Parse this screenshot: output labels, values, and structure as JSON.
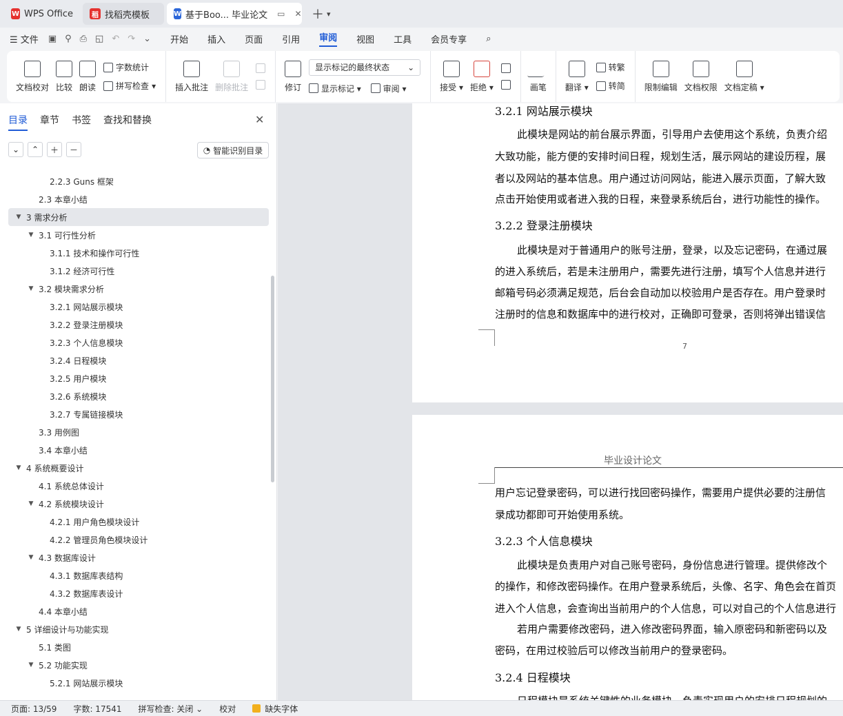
{
  "tabs": [
    {
      "label": "WPS Office"
    },
    {
      "label": "找稻壳模板"
    },
    {
      "label": "基于Boo... 毕业论文"
    }
  ],
  "menubar": {
    "file": "文件",
    "tabs": [
      "开始",
      "插入",
      "页面",
      "引用",
      "审阅",
      "视图",
      "工具",
      "会员专享"
    ],
    "selected_tab": "审阅"
  },
  "ribbon": {
    "doc_check": "文档校对",
    "compare": "比较",
    "read": "朗读",
    "word_count": "字数统计",
    "spell_check": "拼写检查",
    "insert_comment": "插入批注",
    "delete_comment": "删除批注",
    "track_changes": "修订",
    "show_markup_state": "显示标记的最终状态",
    "show_markup": "显示标记",
    "review": "审阅",
    "accept": "接受",
    "reject": "拒绝",
    "pen": "画笔",
    "translate": "翻译",
    "to_traditional": "转繁",
    "to_simplified": "转简",
    "restrict_edit": "限制编辑",
    "doc_permission": "文档权限",
    "doc_finalize": "文档定稿"
  },
  "nav": {
    "tabs": [
      "目录",
      "章节",
      "书签",
      "查找和替换"
    ],
    "smart_toc": "智能识别目录",
    "items": [
      {
        "text": "2.2.3 Guns 框架",
        "level": 3,
        "arrow": ""
      },
      {
        "text": "2.3  本章小结",
        "level": 2,
        "arrow": ""
      },
      {
        "text": "3  需求分析",
        "level": 1,
        "arrow": "▼",
        "selected": true
      },
      {
        "text": "3.1  可行性分析",
        "level": 2,
        "arrow": "▼"
      },
      {
        "text": "3.1.1 技术和操作可行性",
        "level": 3,
        "arrow": ""
      },
      {
        "text": "3.1.2 经济可行性",
        "level": 3,
        "arrow": ""
      },
      {
        "text": "3.2  模块需求分析",
        "level": 2,
        "arrow": "▼"
      },
      {
        "text": "3.2.1  网站展示模块",
        "level": 3,
        "arrow": ""
      },
      {
        "text": "3.2.2  登录注册模块",
        "level": 3,
        "arrow": ""
      },
      {
        "text": "3.2.3  个人信息模块",
        "level": 3,
        "arrow": ""
      },
      {
        "text": "3.2.4  日程模块",
        "level": 3,
        "arrow": ""
      },
      {
        "text": "3.2.5  用户模块",
        "level": 3,
        "arrow": ""
      },
      {
        "text": "3.2.6  系统模块",
        "level": 3,
        "arrow": ""
      },
      {
        "text": "3.2.7  专属链接模块",
        "level": 3,
        "arrow": ""
      },
      {
        "text": "3.3  用例图",
        "level": 2,
        "arrow": ""
      },
      {
        "text": "3.4  本章小结",
        "level": 2,
        "arrow": ""
      },
      {
        "text": "4  系统概要设计",
        "level": 1,
        "arrow": "▼"
      },
      {
        "text": "4.1  系统总体设计",
        "level": 2,
        "arrow": ""
      },
      {
        "text": "4.2  系统模块设计",
        "level": 2,
        "arrow": "▼"
      },
      {
        "text": "4.2.1  用户角色模块设计",
        "level": 3,
        "arrow": ""
      },
      {
        "text": "4.2.2  管理员角色模块设计",
        "level": 3,
        "arrow": ""
      },
      {
        "text": "4.3  数据库设计",
        "level": 2,
        "arrow": "▼"
      },
      {
        "text": "4.3.1  数据库表结构",
        "level": 3,
        "arrow": ""
      },
      {
        "text": "4.3.2  数据库表设计",
        "level": 3,
        "arrow": ""
      },
      {
        "text": "4.4  本章小结",
        "level": 2,
        "arrow": ""
      },
      {
        "text": "5  详细设计与功能实现",
        "level": 1,
        "arrow": "▼"
      },
      {
        "text": "5.1  类图",
        "level": 2,
        "arrow": ""
      },
      {
        "text": "5.2  功能实现",
        "level": 2,
        "arrow": "▼"
      },
      {
        "text": "5.2.1  网站展示模块",
        "level": 3,
        "arrow": ""
      }
    ]
  },
  "page1": {
    "h1": "3.2.1  网站展示模块",
    "p1": [
      "此模块是网站的前台展示界面，引导用户去使用这个系统，负责介绍",
      "大致功能，能方便的安排时间日程，规划生活，展示网站的建设历程，展",
      "者以及网站的基本信息。用户通过访问网站，能进入展示页面，了解大致",
      "点击开始使用或者进入我的日程，来登录系统后台，进行功能性的操作。"
    ],
    "h2": "3.2.2  登录注册模块",
    "p2": [
      "此模块是对于普通用户的账号注册，登录，以及忘记密码，在通过展",
      "的进入系统后，若是未注册用户，需要先进行注册，填写个人信息并进行",
      "邮箱号码必须满足规范，后台会自动加以校验用户是否存在。用户登录时",
      "注册时的信息和数据库中的进行校对，正确即可登录，否则将弹出错误信"
    ],
    "page_number": "7"
  },
  "page2": {
    "header": "毕业设计论文",
    "p0": [
      "用户忘记登录密码，可以进行找回密码操作，需要用户提供必要的注册信",
      "录成功都即可开始使用系统。"
    ],
    "h3": "3.2.3  个人信息模块",
    "p3": [
      "此模块是负责用户对自己账号密码，身份信息进行管理。提供修改个",
      "的操作，和修改密码操作。在用户登录系统后，头像、名字、角色会在首页",
      "进入个人信息，会查询出当前用户的个人信息，可以对自己的个人信息进行",
      "若用户需要修改密码，进入修改密码界面，输入原密码和新密码以及",
      "密码，在用过校验后可以修改当前用户的登录密码。"
    ],
    "h4": "3.2.4  日程模块",
    "p4": "日程模块是系统关键性的业务模块，负责实现用户的安排日程规划的"
  },
  "status": {
    "page": "页面: 13/59",
    "words": "字数: 17541",
    "spell": "拼写检查: 关闭",
    "proof": "校对",
    "missing_font": "缺失字体"
  }
}
